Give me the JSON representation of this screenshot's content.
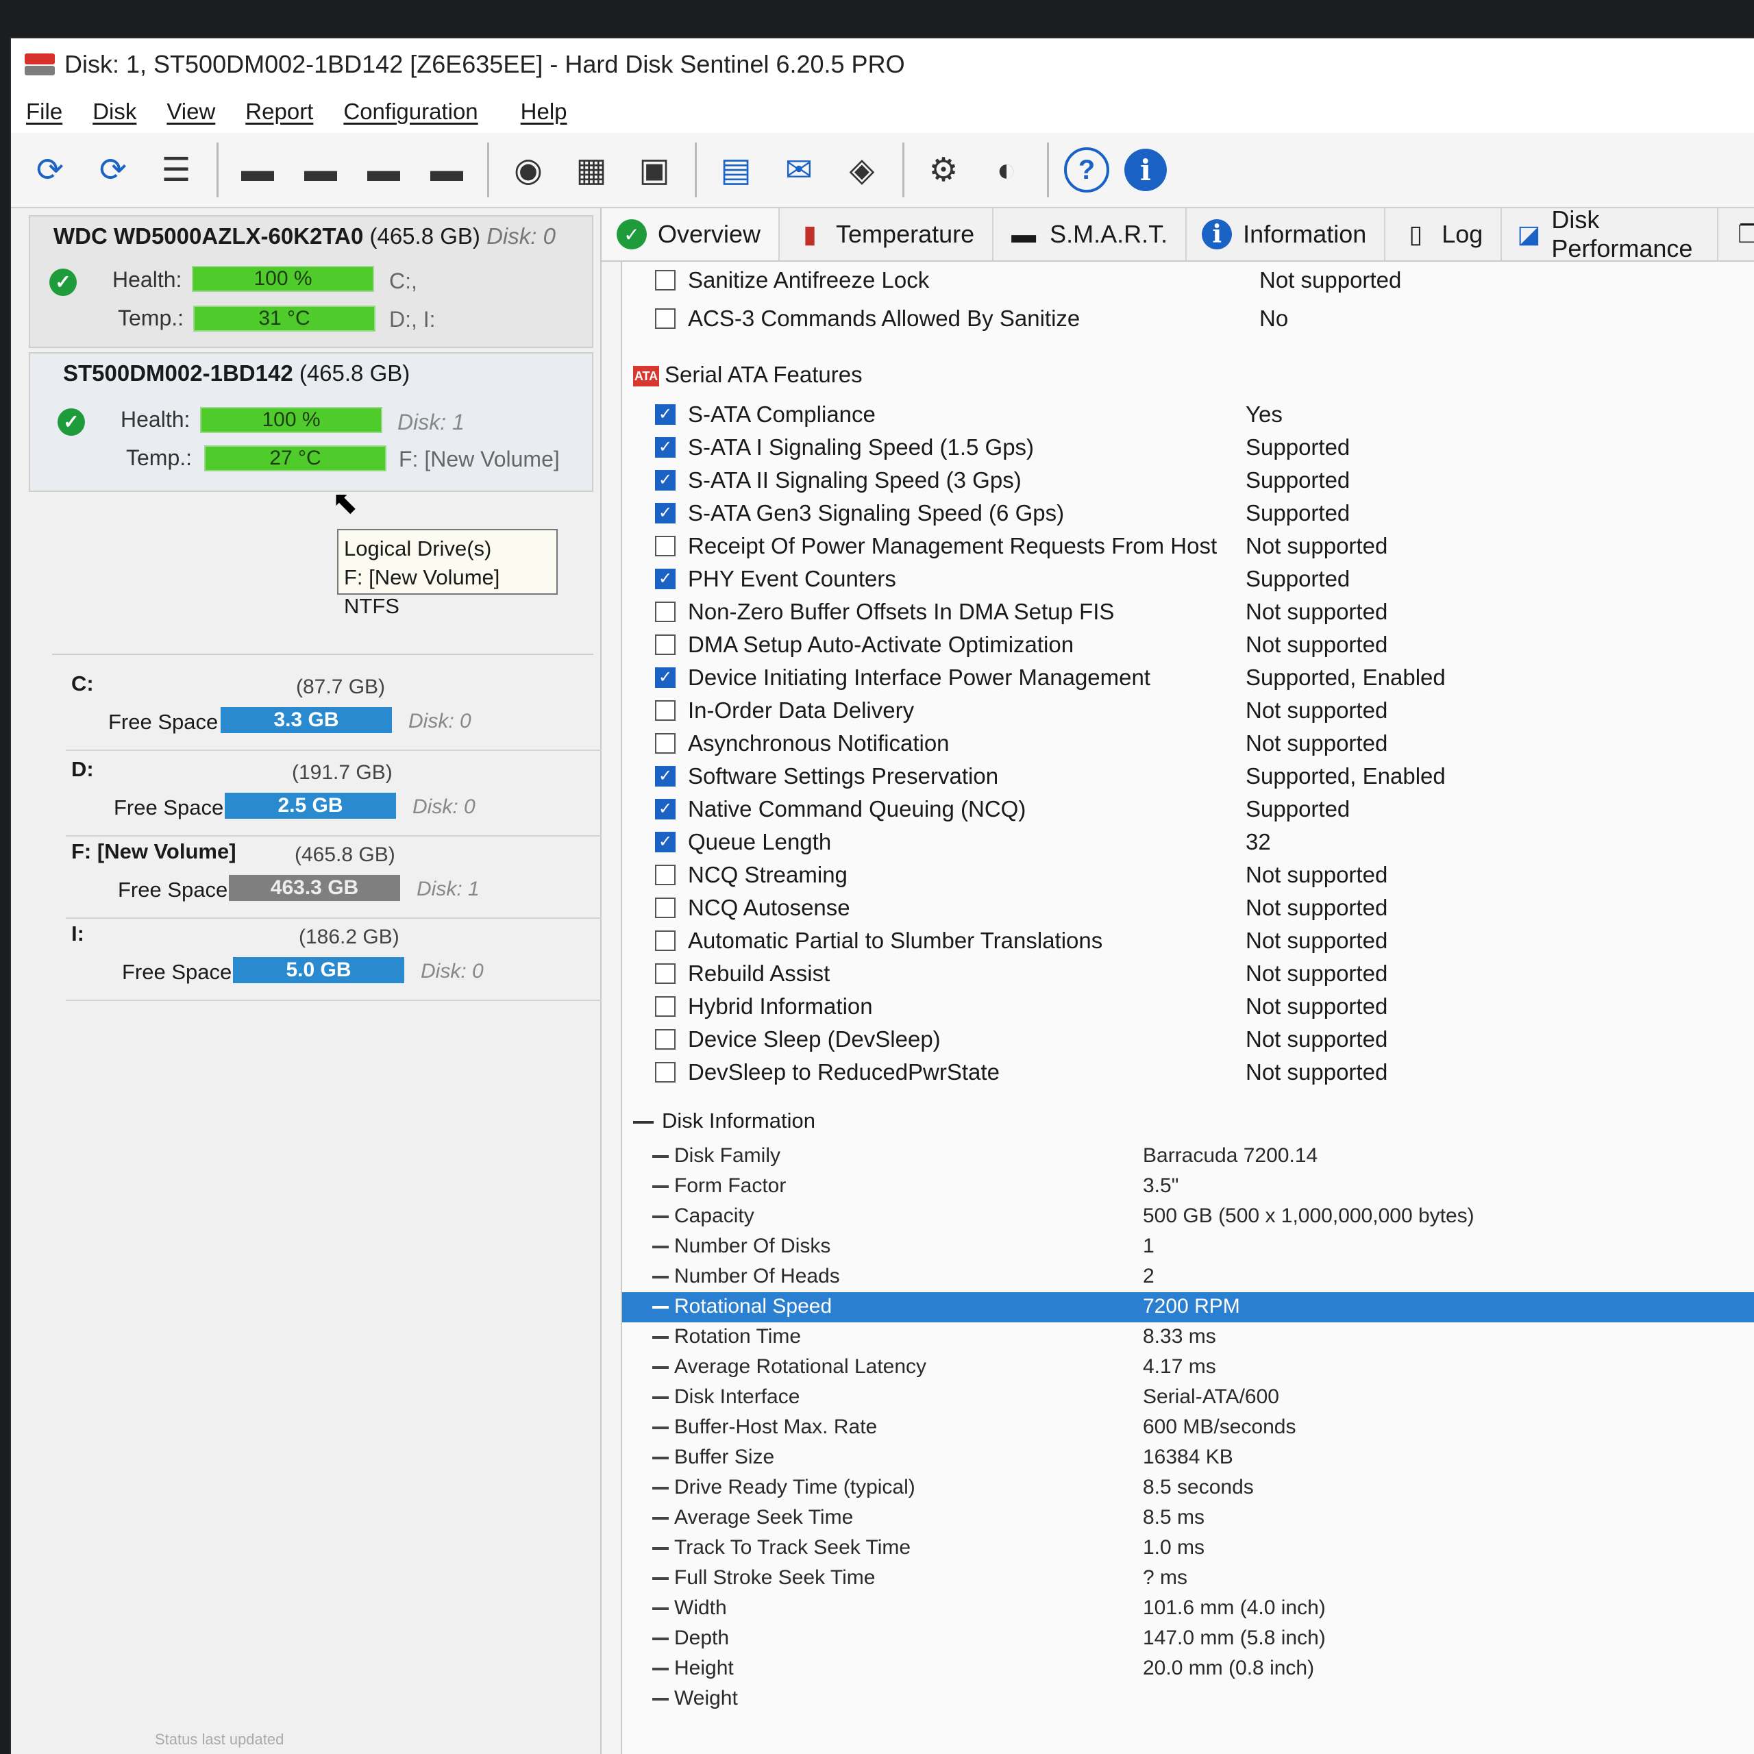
{
  "window": {
    "title": "Disk: 1, ST500DM002-1BD142 [Z6E635EE]  -  Hard Disk Sentinel 6.20.5 PRO"
  },
  "menu": [
    "File",
    "Disk",
    "View",
    "Report",
    "Configuration",
    "Help"
  ],
  "toolbar_icons": [
    [
      "refresh-icon",
      "⟳"
    ],
    [
      "refresh-alert-icon",
      "⟳"
    ],
    [
      "disk-list-icon",
      "☰"
    ],
    [
      "disk-tools-icon",
      "▬"
    ],
    [
      "disk-schedule-icon",
      "▬"
    ],
    [
      "disk-ok-icon",
      "▬"
    ],
    [
      "disk-search-icon",
      "▬"
    ],
    [
      "backup-icon",
      "◉"
    ],
    [
      "network-icon",
      "▦"
    ],
    [
      "print-icon",
      "▣"
    ],
    [
      "report-icon",
      "▤"
    ],
    [
      "email-icon",
      "✉"
    ],
    [
      "web-icon",
      "◈"
    ],
    [
      "settings-gear-icon",
      "⚙"
    ],
    [
      "sound-icon",
      "◐"
    ],
    [
      "help-icon",
      "?"
    ],
    [
      "info-icon",
      "i"
    ]
  ],
  "disks": [
    {
      "name": "WDC WD5000AZLX-60K2TA0",
      "size": "(465.8 GB)",
      "tag": "Disk: 0",
      "health_label": "Health:",
      "health": "100 %",
      "temp_label": "Temp.:",
      "temp": "31 °C",
      "drives": "C:,",
      "drives2": "D:, I:"
    },
    {
      "name": "ST500DM002-1BD142",
      "size": "(465.8 GB)",
      "health_label": "Health:",
      "health": "100 %",
      "disk_tag": "Disk: 1",
      "temp_label": "Temp.:",
      "temp": "27 °C",
      "volume": "F: [New Volume]"
    }
  ],
  "tooltip": {
    "line1": "Logical Drive(s)",
    "line2": "F: [New Volume] NTFS"
  },
  "volumes": [
    {
      "name": "C:",
      "size": "(87.7 GB)",
      "free_label": "Free Space",
      "free": "3.3 GB",
      "disk": "Disk: 0"
    },
    {
      "name": "D:",
      "size": "(191.7 GB)",
      "free_label": "Free Space",
      "free": "2.5 GB",
      "disk": "Disk: 0"
    },
    {
      "name": "F: [New Volume]",
      "size": "(465.8 GB)",
      "free_label": "Free Space",
      "free": "463.3 GB",
      "disk": "Disk: 1"
    },
    {
      "name": "I:",
      "size": "(186.2 GB)",
      "free_label": "Free Space",
      "free": "5.0 GB",
      "disk": "Disk: 0"
    }
  ],
  "status": "Status last updated",
  "tabs": [
    "Overview",
    "Temperature",
    "S.M.A.R.T.",
    "Information",
    "Log",
    "Disk Performance"
  ],
  "sanitize_rows": [
    {
      "label": "Sanitize Antifreeze Lock",
      "value": "Not supported",
      "checked": false
    },
    {
      "label": "ACS-3 Commands Allowed By Sanitize",
      "value": "No",
      "checked": false
    }
  ],
  "sata_section": "Serial ATA Features",
  "sata_rows": [
    {
      "label": "S-ATA Compliance",
      "value": "Yes",
      "checked": true
    },
    {
      "label": "S-ATA I Signaling Speed (1.5 Gps)",
      "value": "Supported",
      "checked": true
    },
    {
      "label": "S-ATA II Signaling Speed (3 Gps)",
      "value": "Supported",
      "checked": true
    },
    {
      "label": "S-ATA Gen3 Signaling Speed (6 Gps)",
      "value": "Supported",
      "checked": true
    },
    {
      "label": "Receipt Of Power Management Requests From Host",
      "value": "Not supported",
      "checked": false
    },
    {
      "label": "PHY Event Counters",
      "value": "Supported",
      "checked": true
    },
    {
      "label": "Non-Zero Buffer Offsets In DMA Setup FIS",
      "value": "Not supported",
      "checked": false
    },
    {
      "label": "DMA Setup Auto-Activate Optimization",
      "value": "Not supported",
      "checked": false
    },
    {
      "label": "Device Initiating Interface Power Management",
      "value": "Supported, Enabled",
      "checked": true
    },
    {
      "label": "In-Order Data Delivery",
      "value": "Not supported",
      "checked": false
    },
    {
      "label": "Asynchronous Notification",
      "value": "Not supported",
      "checked": false
    },
    {
      "label": "Software Settings Preservation",
      "value": "Supported, Enabled",
      "checked": true
    },
    {
      "label": "Native Command Queuing (NCQ)",
      "value": "Supported",
      "checked": true
    },
    {
      "label": "Queue Length",
      "value": "32",
      "checked": true
    },
    {
      "label": "NCQ Streaming",
      "value": "Not supported",
      "checked": false
    },
    {
      "label": "NCQ Autosense",
      "value": "Not supported",
      "checked": false
    },
    {
      "label": "Automatic Partial to Slumber Translations",
      "value": "Not supported",
      "checked": false
    },
    {
      "label": "Rebuild Assist",
      "value": "Not supported",
      "checked": false
    },
    {
      "label": "Hybrid Information",
      "value": "Not supported",
      "checked": false
    },
    {
      "label": "Device Sleep (DevSleep)",
      "value": "Not supported",
      "checked": false
    },
    {
      "label": "DevSleep to ReducedPwrState",
      "value": "Not supported",
      "checked": false
    }
  ],
  "disk_info_section": "Disk Information",
  "disk_info_rows": [
    {
      "label": "Disk Family",
      "value": "Barracuda 7200.14"
    },
    {
      "label": "Form Factor",
      "value": "3.5\""
    },
    {
      "label": "Capacity",
      "value": "500 GB (500 x 1,000,000,000 bytes)"
    },
    {
      "label": "Number Of Disks",
      "value": "1"
    },
    {
      "label": "Number Of Heads",
      "value": "2"
    },
    {
      "label": "Rotational Speed",
      "value": "7200 RPM",
      "selected": true
    },
    {
      "label": "Rotation Time",
      "value": "8.33 ms"
    },
    {
      "label": "Average Rotational Latency",
      "value": "4.17 ms"
    },
    {
      "label": "Disk Interface",
      "value": "Serial-ATA/600"
    },
    {
      "label": "Buffer-Host Max. Rate",
      "value": "600 MB/seconds"
    },
    {
      "label": "Buffer Size",
      "value": "16384 KB"
    },
    {
      "label": "Drive Ready Time (typical)",
      "value": "8.5 seconds"
    },
    {
      "label": "Average Seek Time",
      "value": "8.5 ms"
    },
    {
      "label": "Track To Track Seek Time",
      "value": "1.0 ms"
    },
    {
      "label": "Full Stroke Seek Time",
      "value": "? ms"
    },
    {
      "label": "Width",
      "value": "101.6 mm (4.0 inch)"
    },
    {
      "label": "Depth",
      "value": "147.0 mm (5.8 inch)"
    },
    {
      "label": "Height",
      "value": "20.0 mm (0.8 inch)"
    },
    {
      "label": "Weight",
      "value": ""
    }
  ]
}
